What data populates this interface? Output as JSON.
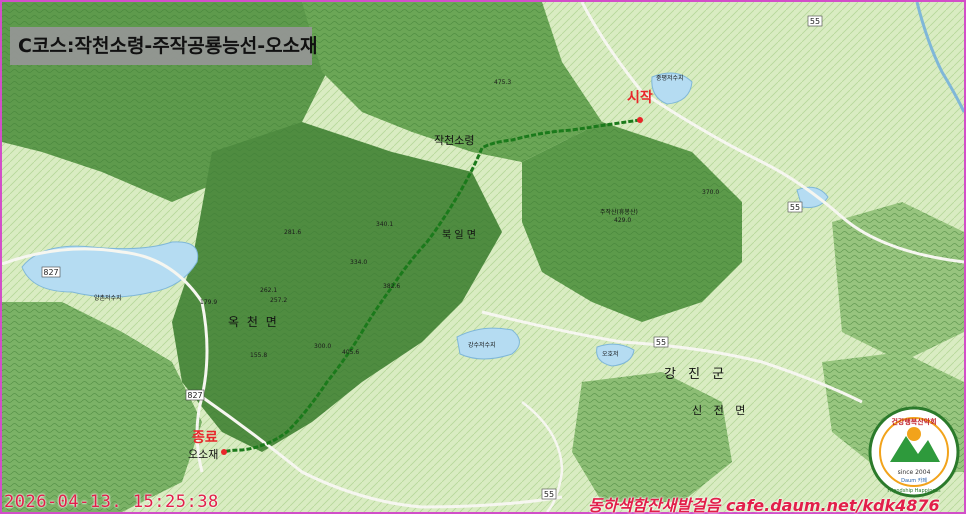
{
  "title": "C코스:작천소령-주작공룡능선-오소재",
  "markers": {
    "start": "시작",
    "end": "종료"
  },
  "places": {
    "pass_start": "작천소령",
    "pass_end": "오소재",
    "township_buk": "북 일 면",
    "township_ok": "옥 천 면",
    "county_gangjin": "강 진 군",
    "township_sinjeon": "신 전 면",
    "reservoir_yangchon": "양촌저수지",
    "reservoir_gangsu": "강수저수지",
    "reservoir_oho": "오호저",
    "reservoir_jungpyeong": "중평저수지",
    "peak_jujak": "주작산(휴봉산)"
  },
  "road_markers": [
    "55",
    "55",
    "55",
    "55",
    "827",
    "827"
  ],
  "spot_heights": [
    "475.3",
    "429.0",
    "405.6",
    "382.6",
    "370.0",
    "334.0",
    "300.0",
    "257.2",
    "262.1",
    "281.6",
    "340.1",
    "179.9",
    "155.8"
  ],
  "timestamp": "2026-04-13. 15:25:38",
  "credit": "동하색함잔새발걸음 cafe.daum.net/kdk4876",
  "logo": {
    "top_text": "건강행복산악회",
    "bottom_text": "Friendship Happiness",
    "since": "since 2004",
    "brand": "Daum 카페"
  },
  "colors": {
    "frame": "#d24fc9",
    "route": "#1b7a1b",
    "accent_red": "#e8262a",
    "water": "#b5dcf2"
  }
}
